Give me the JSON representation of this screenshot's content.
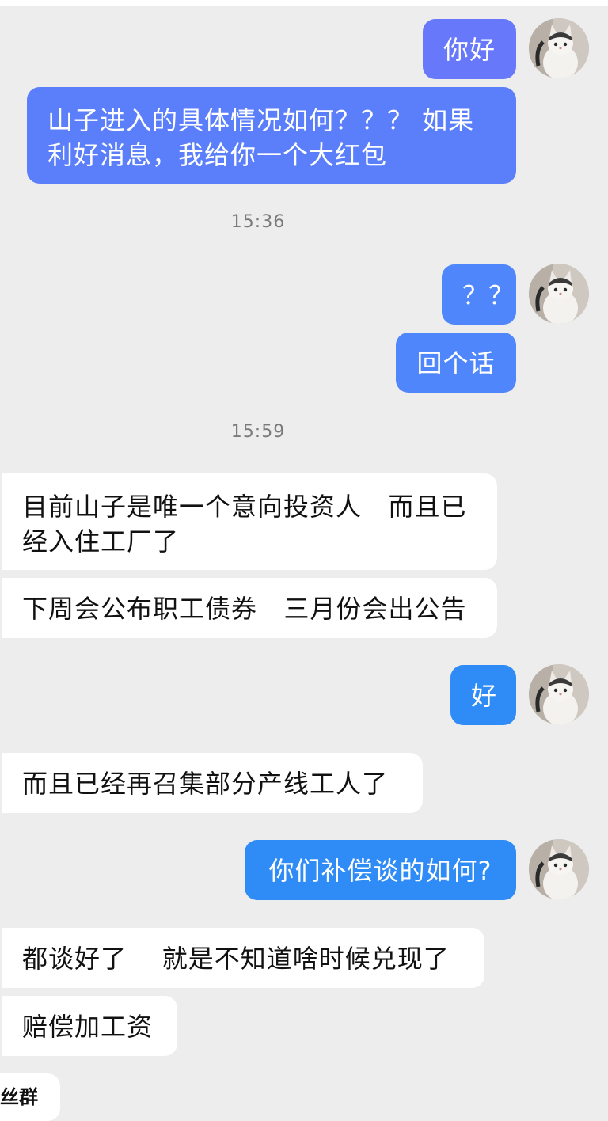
{
  "colors": {
    "background": "#ededed",
    "outgoing_violet": "#6778fb",
    "outgoing_blue": "#4f86fb",
    "outgoing_sky": "#2f8cf7",
    "incoming": "#ffffff",
    "timestamp": "#7a7a7a"
  },
  "avatar_icon": "white-cat-avatar-icon",
  "messages": {
    "m1": "你好",
    "m2": "山子进入的具体情况如何？？？ 如果利好消息，我给你一个大红包",
    "time1": "15:36",
    "m3": "？？",
    "m4": "回个话",
    "time2": "15:59",
    "m5": "目前山子是唯一个意向投资人   而且已经入住工厂了",
    "m6": "下周会公布职工债券   三月份会出公告",
    "m7": "好",
    "m8": "而且已经再召集部分产线工人了",
    "m9": "你们补偿谈的如何?",
    "m10": "都谈好了    就是不知道啥时候兑现了",
    "m11": "赔偿加工资",
    "partial_label": "丝群"
  }
}
